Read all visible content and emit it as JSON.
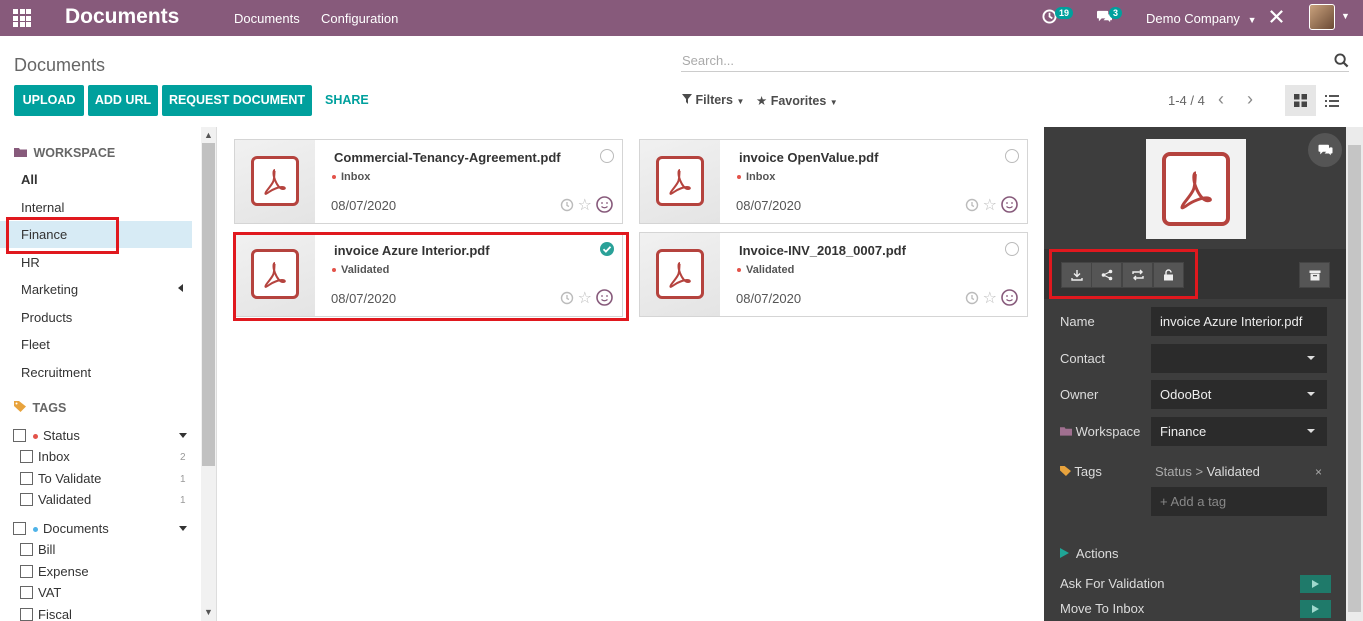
{
  "topbar": {
    "brand": "Documents",
    "menu": [
      "Documents",
      "Configuration"
    ],
    "activity_count": "19",
    "message_count": "3",
    "company": "Demo Company"
  },
  "control_panel": {
    "title": "Documents",
    "search_placeholder": "Search...",
    "buttons": [
      "UPLOAD",
      "ADD URL",
      "REQUEST DOCUMENT"
    ],
    "share_label": "SHARE",
    "filters_label": "Filters",
    "favorites_label": "Favorites",
    "pager": "1-4 / 4"
  },
  "sidebar": {
    "workspace_title": "WORKSPACE",
    "workspaces": [
      "All",
      "Internal",
      "Finance",
      "HR",
      "Marketing",
      "Products",
      "Fleet",
      "Recruitment"
    ],
    "tags_title": "TAGS",
    "status_group": "Status",
    "status_tags": [
      {
        "label": "Inbox",
        "count": "2"
      },
      {
        "label": "To Validate",
        "count": "1"
      },
      {
        "label": "Validated",
        "count": "1"
      }
    ],
    "documents_group": "Documents",
    "document_tags": [
      "Bill",
      "Expense",
      "VAT",
      "Fiscal"
    ]
  },
  "cards": [
    {
      "name": "Commercial-Tenancy-Agreement.pdf",
      "tag": "Inbox",
      "date": "08/07/2020",
      "selected": false
    },
    {
      "name": "invoice OpenValue.pdf",
      "tag": "Inbox",
      "date": "08/07/2020",
      "selected": false
    },
    {
      "name": "invoice Azure Interior.pdf",
      "tag": "Validated",
      "date": "08/07/2020",
      "selected": true
    },
    {
      "name": "Invoice-INV_2018_0007.pdf",
      "tag": "Validated",
      "date": "08/07/2020",
      "selected": false
    }
  ],
  "inspector": {
    "name_label": "Name",
    "name_value": "invoice Azure Interior.pdf",
    "contact_label": "Contact",
    "contact_value": "",
    "owner_label": "Owner",
    "owner_value": "OdooBot",
    "workspace_label": "Workspace",
    "workspace_value": "Finance",
    "tags_label": "Tags",
    "tag_prefix": "Status > ",
    "tag_value": "Validated",
    "add_tag_placeholder": "+ Add a tag",
    "actions_label": "Actions",
    "actions": [
      "Ask For Validation",
      "Move To Inbox"
    ]
  },
  "colors": {
    "topbar": "#875a7b",
    "primary": "#00a09d",
    "highlight_box": "#e0181e",
    "pdf_red": "#b5433e"
  }
}
